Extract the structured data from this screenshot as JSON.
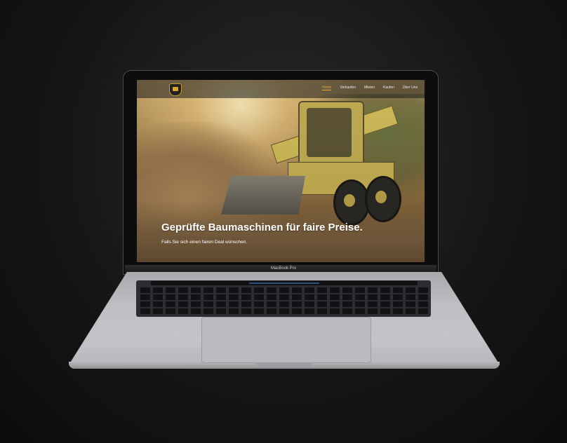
{
  "device": {
    "brand_label": "MacBook Pro"
  },
  "website": {
    "nav": {
      "items": [
        {
          "label": "Home",
          "active": true
        },
        {
          "label": "Verkaufen",
          "active": false
        },
        {
          "label": "Mieten",
          "active": false
        },
        {
          "label": "Kaufen",
          "active": false
        },
        {
          "label": "Über Uns",
          "active": false
        }
      ]
    },
    "hero": {
      "headline": "Geprüfte Baumaschinen für faire Preise.",
      "subline": "Falls Sie sich einen fairen Deal wünschen."
    }
  },
  "colors": {
    "accent": "#e0a93a",
    "nav_text": "#e8e8e8"
  }
}
